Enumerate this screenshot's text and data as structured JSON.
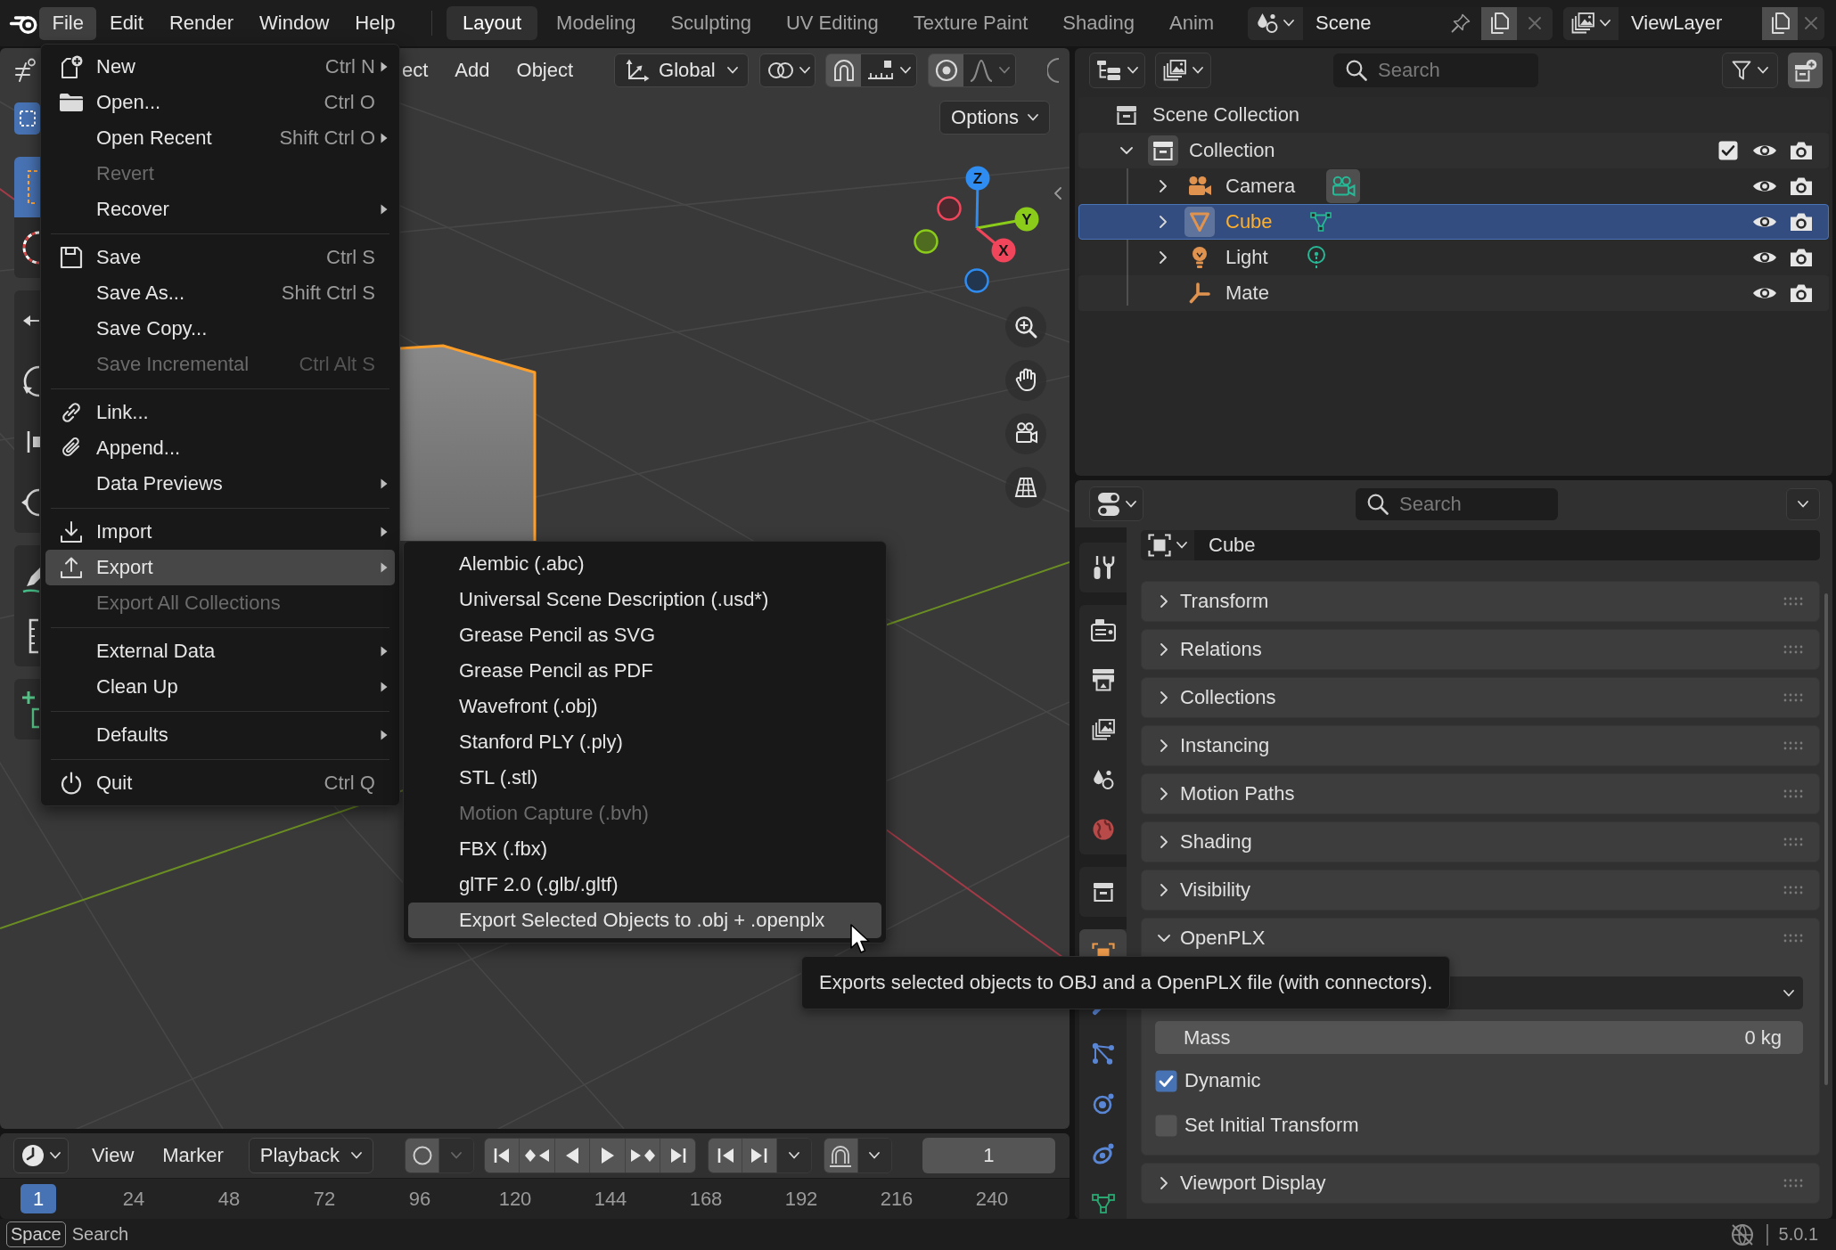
{
  "top_bar": {
    "menus": [
      {
        "label": "File",
        "selected": true
      },
      {
        "label": "Edit",
        "selected": false
      },
      {
        "label": "Render",
        "selected": false
      },
      {
        "label": "Window",
        "selected": false
      },
      {
        "label": "Help",
        "selected": false
      }
    ],
    "workspaces": [
      {
        "label": "Layout",
        "selected": true
      },
      {
        "label": "Modeling",
        "selected": false
      },
      {
        "label": "Sculpting",
        "selected": false
      },
      {
        "label": "UV Editing",
        "selected": false
      },
      {
        "label": "Texture Paint",
        "selected": false
      },
      {
        "label": "Shading",
        "selected": false
      },
      {
        "label": "Anim",
        "selected": false
      }
    ],
    "scene": "Scene",
    "view_layer": "ViewLayer"
  },
  "viewport": {
    "select_modes": [
      {
        "kind": "box",
        "selected": true
      }
    ],
    "header_menus": [
      "ect",
      "Add",
      "Object"
    ],
    "orientation": "Global",
    "options": "Options",
    "toolbar": [
      {
        "tools": [
          {
            "kind": "select",
            "selected": true
          },
          {
            "kind": "cursor",
            "selected": false
          }
        ]
      },
      {
        "tools": [
          {
            "kind": "move",
            "selected": false
          },
          {
            "kind": "rotate",
            "selected": false
          },
          {
            "kind": "scale",
            "selected": false
          },
          {
            "kind": "transform",
            "selected": false
          }
        ]
      },
      {
        "tools": [
          {
            "kind": "annotate",
            "selected": false
          },
          {
            "kind": "measure",
            "selected": false
          }
        ]
      },
      {
        "tools": [
          {
            "kind": "add",
            "selected": false
          }
        ]
      }
    ],
    "axes": [
      {
        "kind": "z",
        "label": "Z"
      },
      {
        "kind": "y",
        "label": "Y"
      },
      {
        "kind": "x",
        "label": "X"
      }
    ]
  },
  "file_menu": {
    "groups": [
      {
        "items": [
          {
            "kind": "new",
            "label": "New",
            "shortcut": "Ctrl N",
            "submenu": true,
            "disabled": false,
            "selected": false
          },
          {
            "kind": "open",
            "label": "Open...",
            "shortcut": "Ctrl O",
            "submenu": false,
            "disabled": false,
            "selected": false
          },
          {
            "kind": "plain",
            "label": "Open Recent",
            "shortcut": "Shift Ctrl O",
            "submenu": true,
            "disabled": false,
            "selected": false
          },
          {
            "kind": "plain",
            "label": "Revert",
            "submenu": false,
            "disabled": true,
            "selected": false
          },
          {
            "kind": "plain",
            "label": "Recover",
            "submenu": true,
            "disabled": false,
            "selected": false
          }
        ]
      },
      {
        "items": [
          {
            "kind": "save",
            "label": "Save",
            "shortcut": "Ctrl S",
            "submenu": false,
            "disabled": false,
            "selected": false
          },
          {
            "kind": "plain",
            "label": "Save As...",
            "shortcut": "Shift Ctrl S",
            "submenu": false,
            "disabled": false,
            "selected": false
          },
          {
            "kind": "plain",
            "label": "Save Copy...",
            "submenu": false,
            "disabled": false,
            "selected": false
          },
          {
            "kind": "plain",
            "label": "Save Incremental",
            "shortcut": "Ctrl Alt S",
            "submenu": false,
            "disabled": true,
            "selected": false
          }
        ]
      },
      {
        "items": [
          {
            "kind": "link",
            "label": "Link...",
            "submenu": false,
            "disabled": false,
            "selected": false
          },
          {
            "kind": "append",
            "label": "Append...",
            "submenu": false,
            "disabled": false,
            "selected": false
          },
          {
            "kind": "plain",
            "label": "Data Previews",
            "submenu": true,
            "disabled": false,
            "selected": false
          }
        ]
      },
      {
        "items": [
          {
            "kind": "import",
            "label": "Import",
            "submenu": true,
            "disabled": false,
            "selected": false
          },
          {
            "kind": "export",
            "label": "Export",
            "submenu": true,
            "disabled": false,
            "selected": true
          },
          {
            "kind": "plain",
            "label": "Export All Collections",
            "submenu": false,
            "disabled": true,
            "selected": false
          }
        ]
      },
      {
        "items": [
          {
            "kind": "plain",
            "label": "External Data",
            "submenu": true,
            "disabled": false,
            "selected": false
          },
          {
            "kind": "plain",
            "label": "Clean Up",
            "submenu": true,
            "disabled": false,
            "selected": false
          }
        ]
      },
      {
        "items": [
          {
            "kind": "plain",
            "label": "Defaults",
            "submenu": true,
            "disabled": false,
            "selected": false
          }
        ]
      },
      {
        "items": [
          {
            "kind": "quit",
            "label": "Quit",
            "shortcut": "Ctrl Q",
            "submenu": false,
            "disabled": false,
            "selected": false
          }
        ]
      }
    ]
  },
  "export_menu": {
    "items": [
      {
        "label": "Alembic (.abc)",
        "disabled": false,
        "selected": false
      },
      {
        "label": "Universal Scene Description (.usd*)",
        "disabled": false,
        "selected": false
      },
      {
        "label": "Grease Pencil as SVG",
        "disabled": false,
        "selected": false
      },
      {
        "label": "Grease Pencil as PDF",
        "disabled": false,
        "selected": false
      },
      {
        "label": "Wavefront (.obj)",
        "disabled": false,
        "selected": false
      },
      {
        "label": "Stanford PLY (.ply)",
        "disabled": false,
        "selected": false
      },
      {
        "label": "STL (.stl)",
        "disabled": false,
        "selected": false
      },
      {
        "label": "Motion Capture (.bvh)",
        "disabled": true,
        "selected": false
      },
      {
        "label": "FBX (.fbx)",
        "disabled": false,
        "selected": false
      },
      {
        "label": "glTF 2.0 (.glb/.gltf)",
        "disabled": false,
        "selected": false
      },
      {
        "label": "Export Selected Objects to .obj + .openplx",
        "disabled": false,
        "selected": true
      }
    ]
  },
  "tooltip": {
    "text": "Exports selected objects to OBJ and a OpenPLX file (with connectors)."
  },
  "outliner": {
    "search_placeholder": "Search",
    "tree": [
      {
        "label": "Scene Collection",
        "kind": "scene_collection",
        "selected": false,
        "icon_active": false,
        "children": [
          {
            "label": "Collection",
            "kind": "collection",
            "selected": false,
            "expanded": true,
            "checked": true,
            "icon_active": true,
            "children": [
              {
                "label": "Camera",
                "kind": "camera",
                "selected": false,
                "expanded": false,
                "icon_active": false,
                "data_active": true
              },
              {
                "label": "Cube",
                "kind": "mesh",
                "selected": true,
                "expanded": false,
                "icon_active": true,
                "data_active": false
              },
              {
                "label": "Light",
                "kind": "light",
                "selected": false,
                "expanded": false,
                "icon_active": false,
                "data_active": false
              },
              {
                "label": "Mate",
                "kind": "empty",
                "selected": false,
                "icon_active": false
              }
            ]
          }
        ]
      }
    ]
  },
  "properties": {
    "search_placeholder": "Search",
    "tab_groups": [
      {
        "tabs": [
          {
            "kind": "tool",
            "selected": false
          }
        ]
      },
      {
        "tabs": [
          {
            "kind": "render",
            "selected": false
          },
          {
            "kind": "output",
            "selected": false
          },
          {
            "kind": "view_layer",
            "selected": false
          },
          {
            "kind": "scene",
            "selected": false
          },
          {
            "kind": "world",
            "selected": false
          }
        ]
      },
      {
        "tabs": [
          {
            "kind": "collection",
            "selected": false
          }
        ]
      },
      {
        "tabs": [
          {
            "kind": "object",
            "selected": true
          },
          {
            "kind": "modifiers",
            "selected": false
          },
          {
            "kind": "particles",
            "selected": false
          },
          {
            "kind": "physics",
            "selected": false
          },
          {
            "kind": "constraints",
            "selected": false
          },
          {
            "kind": "data",
            "selected": false
          }
        ]
      }
    ],
    "object_name": "Cube",
    "panels": [
      {
        "title": "Transform",
        "expanded": false
      },
      {
        "title": "Relations",
        "expanded": false
      },
      {
        "title": "Collections",
        "expanded": false
      },
      {
        "title": "Instancing",
        "expanded": false
      },
      {
        "title": "Motion Paths",
        "expanded": false
      },
      {
        "title": "Shading",
        "expanded": false
      },
      {
        "title": "Visibility",
        "expanded": false
      },
      {
        "title": "OpenPLX",
        "expanded": true,
        "fields": [
          {
            "kind": "dropdown"
          },
          {
            "kind": "number",
            "label": "Mass",
            "value": "0 kg"
          },
          {
            "kind": "checkbox",
            "label": "Dynamic",
            "checked": true
          },
          {
            "kind": "checkbox",
            "label": "Set Initial Transform",
            "checked": false
          }
        ]
      },
      {
        "title": "Viewport Display",
        "expanded": false
      }
    ]
  },
  "timeline": {
    "menus": [
      "View",
      "Marker"
    ],
    "playback": "Playback",
    "current_frame": "1",
    "ruler": [
      {
        "label": "1",
        "selected": true
      },
      {
        "label": "24",
        "selected": false
      },
      {
        "label": "48",
        "selected": false
      },
      {
        "label": "72",
        "selected": false
      },
      {
        "label": "96",
        "selected": false
      },
      {
        "label": "120",
        "selected": false
      },
      {
        "label": "144",
        "selected": false
      },
      {
        "label": "168",
        "selected": false
      },
      {
        "label": "192",
        "selected": false
      },
      {
        "label": "216",
        "selected": false
      },
      {
        "label": "240",
        "selected": false
      }
    ]
  },
  "status_bar": {
    "key": "Space",
    "action": "Search",
    "version": "5.0.1"
  }
}
